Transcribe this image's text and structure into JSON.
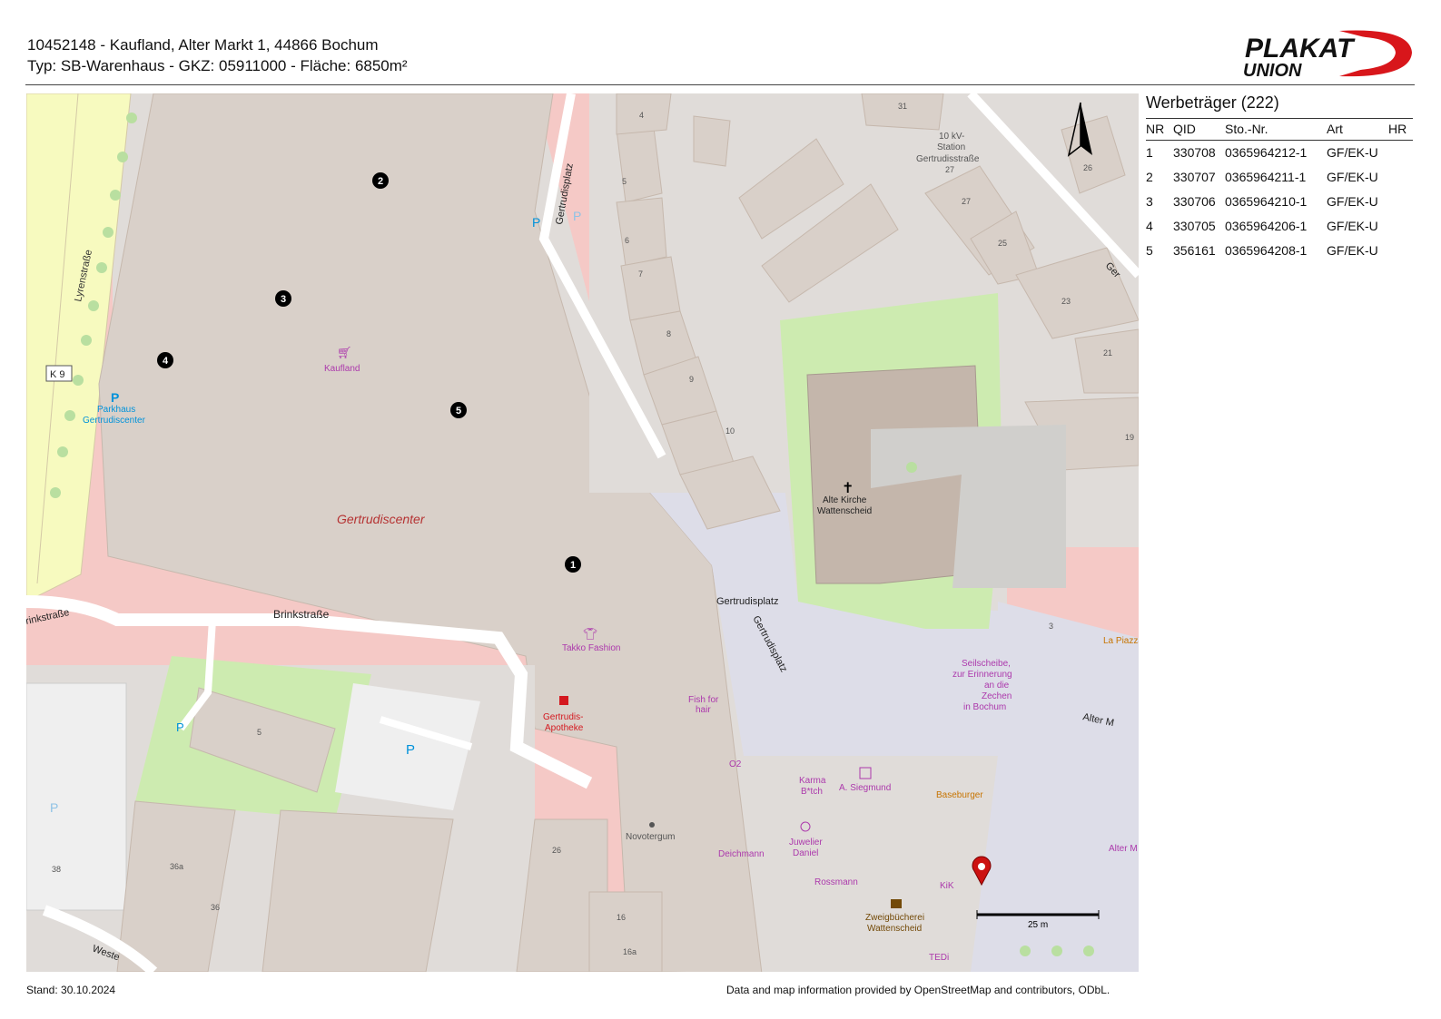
{
  "header": {
    "line1": "10452148 - Kaufland, Alter Markt 1, 44866 Bochum",
    "line2": "Typ: SB-Warenhaus - GKZ: 05911000 - Fläche: 6850m²"
  },
  "logo": {
    "line1": "PLAKAT",
    "line2": "UNION"
  },
  "panel": {
    "title": "Werbeträger (222)",
    "columns": [
      "NR",
      "QID",
      "Sto.-Nr.",
      "Art",
      "HR"
    ],
    "rows": [
      {
        "nr": "1",
        "qid": "330708",
        "sto": "0365964212-1",
        "art": "GF/EK-U",
        "hr": ""
      },
      {
        "nr": "2",
        "qid": "330707",
        "sto": "0365964211-1",
        "art": "GF/EK-U",
        "hr": ""
      },
      {
        "nr": "3",
        "qid": "330706",
        "sto": "0365964210-1",
        "art": "GF/EK-U",
        "hr": ""
      },
      {
        "nr": "4",
        "qid": "330705",
        "sto": "0365964206-1",
        "art": "GF/EK-U",
        "hr": ""
      },
      {
        "nr": "5",
        "qid": "356161",
        "sto": "0365964208-1",
        "art": "GF/EK-U",
        "hr": ""
      }
    ]
  },
  "map": {
    "labels": {
      "lyrenstrasse": "Lyrenstraße",
      "k9": "K 9",
      "parkhaus_1": "Parkhaus",
      "parkhaus_2": "Gertrudiscenter",
      "kaufland": "Kaufland",
      "gertrudiscenter": "Gertrudiscenter",
      "brinkstrasse": "Brinkstraße",
      "brinkstrasse_left": "rinkstraße",
      "gertrudisplatz_road": "Gertrudisplatz",
      "gertrudisplatz_label": "Gertrudisplatz",
      "gertrudisplatz_diag": "Gertrudisplatz",
      "station_1": "10 kV-",
      "station_2": "Station",
      "station_3": "Gertrudisstraße",
      "kirche_1": "Alte Kirche",
      "kirche_2": "Wattenscheid",
      "takko": "Takko Fashion",
      "apotheke_1": "Gertrudis-",
      "apotheke_2": "Apotheke",
      "fish_1": "Fish for",
      "fish_2": "hair",
      "o2": "O2",
      "karma_1": "Karma",
      "karma_2": "B*tch",
      "siegmund": "A. Siegmund",
      "baseburger": "Baseburger",
      "novotergum": "Novotergum",
      "deichmann": "Deichmann",
      "juwelier_1": "Juwelier",
      "juwelier_2": "Daniel",
      "rossmann": "Rossmann",
      "kik": "KiK",
      "zweig_1": "Zweigbücherei",
      "zweig_2": "Wattenscheid",
      "tedi": "TEDi",
      "seil_1": "Seilscheibe,",
      "seil_2": "zur Erinnerung",
      "seil_3": "an die",
      "seil_4": "Zechen",
      "seil_5": "in Bochum",
      "alter_markt": "Alter M",
      "alter_markt_2": "Alter M",
      "la_piazza": "La Piazza",
      "ger_cut": "Ger",
      "westr": "Weste",
      "scale": "25 m"
    },
    "house_numbers": [
      "4",
      "5",
      "6",
      "7",
      "8",
      "9",
      "10",
      "31",
      "27",
      "27",
      "25",
      "26",
      "23",
      "21",
      "19",
      "3",
      "5",
      "38",
      "36a",
      "36",
      "26",
      "16",
      "16a"
    ],
    "markers": [
      "1",
      "2",
      "3",
      "4",
      "5"
    ],
    "parking": [
      "P",
      "P",
      "P",
      "P",
      "P",
      "P"
    ]
  },
  "footer": {
    "stand": "Stand: 30.10.2024",
    "attribution": "Data and map information provided by OpenStreetMap and contributors, ODbL."
  },
  "colors": {
    "building": "#d9d0c9",
    "building_dark": "#c4b6ab",
    "pedestrian": "#dddde8",
    "grass": "#cdebb0",
    "footway": "#f5c9c6",
    "primary_road": "#f7fabf",
    "poi_purple": "#ac39ac",
    "parking_blue": "#0092da",
    "marker_red": "#cc1111"
  }
}
